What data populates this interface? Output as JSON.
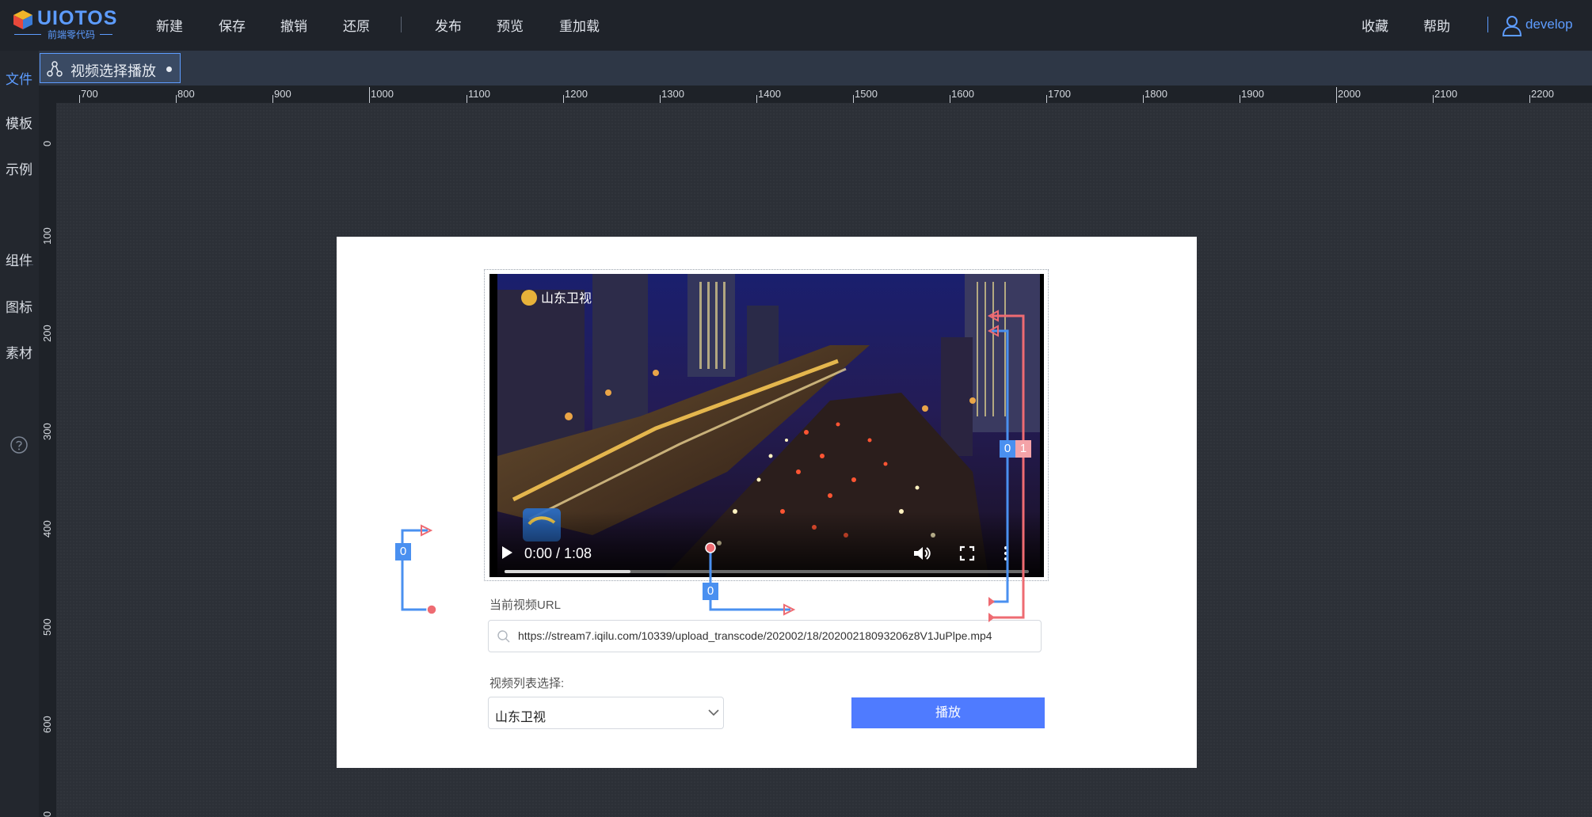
{
  "app": {
    "logo_title": "UIOTOS",
    "logo_subtitle": "前端零代码",
    "menu": [
      "新建",
      "保存",
      "撤销",
      "还原",
      "发布",
      "预览",
      "重加载"
    ],
    "right_menu": [
      "收藏",
      "帮助"
    ],
    "user": "develop"
  },
  "sidebar": {
    "items": [
      "文件",
      "模板",
      "示例",
      "组件",
      "图标",
      "素材"
    ],
    "help_icon": "question-circle-icon"
  },
  "tab": {
    "label": "视频选择播放"
  },
  "ruler": {
    "horizontal": [
      "700",
      "800",
      "900",
      "1000",
      "1100",
      "1200",
      "1300",
      "1400",
      "1500",
      "1600",
      "1700",
      "1800",
      "1900",
      "2000",
      "2100",
      "2200"
    ],
    "vertical": [
      "0",
      "100",
      "200",
      "300",
      "400",
      "500",
      "600",
      "0"
    ]
  },
  "video": {
    "time": "0:00 / 1:08",
    "progress_buffered": 0.24,
    "watermark": "山东卫视"
  },
  "form": {
    "url_label": "当前视频URL",
    "url_value": "https://stream7.iqilu.com/10339/upload_transcode/202002/18/20200218093206z8V1JuPlpe.mp4",
    "list_label": "视频列表选择:",
    "select_value": "山东卫视",
    "play_button": "播放"
  },
  "links": {
    "badge_left": "0",
    "badge_mid": "0",
    "badge_right_blue": "0",
    "badge_right_red": "1",
    "blue": "#4a90f0",
    "red": "#ee6b72"
  },
  "colors": {
    "accent": "#5d9cff",
    "button": "#4f7bff"
  }
}
